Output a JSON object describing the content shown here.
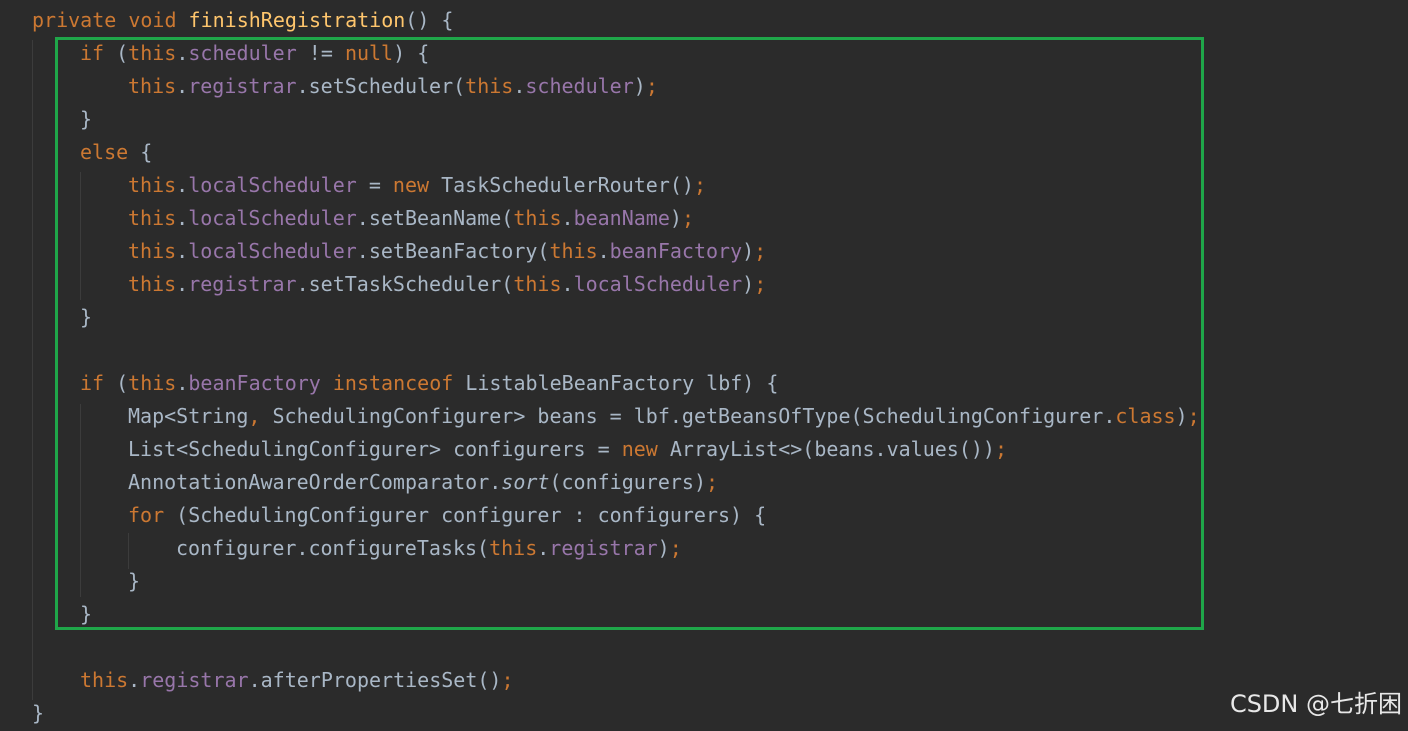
{
  "editor": {
    "theme_colors": {
      "background": "#2b2b2b",
      "keyword": "#cc7832",
      "field": "#9876aa",
      "method_declaration": "#ffc66d",
      "plain": "#a9b7c6",
      "highlight_border": "#1fa649"
    },
    "lines": [
      {
        "indent": 0,
        "tokens": [
          {
            "t": "private void ",
            "c": "keyword"
          },
          {
            "t": "finishRegistration",
            "c": "method_declaration"
          },
          {
            "t": "() {",
            "c": "plain"
          }
        ]
      },
      {
        "indent": 1,
        "tokens": [
          {
            "t": "if ",
            "c": "keyword"
          },
          {
            "t": "(",
            "c": "plain"
          },
          {
            "t": "this",
            "c": "keyword"
          },
          {
            "t": ".",
            "c": "plain"
          },
          {
            "t": "scheduler",
            "c": "field"
          },
          {
            "t": " != ",
            "c": "plain"
          },
          {
            "t": "null",
            "c": "keyword"
          },
          {
            "t": ") {",
            "c": "plain"
          }
        ]
      },
      {
        "indent": 2,
        "tokens": [
          {
            "t": "this",
            "c": "keyword"
          },
          {
            "t": ".",
            "c": "plain"
          },
          {
            "t": "registrar",
            "c": "field"
          },
          {
            "t": ".setScheduler(",
            "c": "plain"
          },
          {
            "t": "this",
            "c": "keyword"
          },
          {
            "t": ".",
            "c": "plain"
          },
          {
            "t": "scheduler",
            "c": "field"
          },
          {
            "t": ")",
            "c": "plain"
          },
          {
            "t": ";",
            "c": "keyword"
          }
        ]
      },
      {
        "indent": 1,
        "tokens": [
          {
            "t": "}",
            "c": "plain"
          }
        ]
      },
      {
        "indent": 1,
        "tokens": [
          {
            "t": "else ",
            "c": "keyword"
          },
          {
            "t": "{",
            "c": "plain"
          }
        ]
      },
      {
        "indent": 2,
        "tokens": [
          {
            "t": "this",
            "c": "keyword"
          },
          {
            "t": ".",
            "c": "plain"
          },
          {
            "t": "localScheduler",
            "c": "field"
          },
          {
            "t": " = ",
            "c": "plain"
          },
          {
            "t": "new ",
            "c": "keyword"
          },
          {
            "t": "TaskSchedulerRouter()",
            "c": "plain"
          },
          {
            "t": ";",
            "c": "keyword"
          }
        ]
      },
      {
        "indent": 2,
        "tokens": [
          {
            "t": "this",
            "c": "keyword"
          },
          {
            "t": ".",
            "c": "plain"
          },
          {
            "t": "localScheduler",
            "c": "field"
          },
          {
            "t": ".setBeanName(",
            "c": "plain"
          },
          {
            "t": "this",
            "c": "keyword"
          },
          {
            "t": ".",
            "c": "plain"
          },
          {
            "t": "beanName",
            "c": "field"
          },
          {
            "t": ")",
            "c": "plain"
          },
          {
            "t": ";",
            "c": "keyword"
          }
        ]
      },
      {
        "indent": 2,
        "tokens": [
          {
            "t": "this",
            "c": "keyword"
          },
          {
            "t": ".",
            "c": "plain"
          },
          {
            "t": "localScheduler",
            "c": "field"
          },
          {
            "t": ".setBeanFactory(",
            "c": "plain"
          },
          {
            "t": "this",
            "c": "keyword"
          },
          {
            "t": ".",
            "c": "plain"
          },
          {
            "t": "beanFactory",
            "c": "field"
          },
          {
            "t": ")",
            "c": "plain"
          },
          {
            "t": ";",
            "c": "keyword"
          }
        ]
      },
      {
        "indent": 2,
        "tokens": [
          {
            "t": "this",
            "c": "keyword"
          },
          {
            "t": ".",
            "c": "plain"
          },
          {
            "t": "registrar",
            "c": "field"
          },
          {
            "t": ".setTaskScheduler(",
            "c": "plain"
          },
          {
            "t": "this",
            "c": "keyword"
          },
          {
            "t": ".",
            "c": "plain"
          },
          {
            "t": "localScheduler",
            "c": "field"
          },
          {
            "t": ")",
            "c": "plain"
          },
          {
            "t": ";",
            "c": "keyword"
          }
        ]
      },
      {
        "indent": 1,
        "tokens": [
          {
            "t": "}",
            "c": "plain"
          }
        ]
      },
      {
        "indent": 0,
        "tokens": []
      },
      {
        "indent": 1,
        "tokens": [
          {
            "t": "if ",
            "c": "keyword"
          },
          {
            "t": "(",
            "c": "plain"
          },
          {
            "t": "this",
            "c": "keyword"
          },
          {
            "t": ".",
            "c": "plain"
          },
          {
            "t": "beanFactory",
            "c": "field"
          },
          {
            "t": " ",
            "c": "plain"
          },
          {
            "t": "instanceof ",
            "c": "keyword"
          },
          {
            "t": "ListableBeanFactory lbf) {",
            "c": "plain"
          }
        ]
      },
      {
        "indent": 2,
        "tokens": [
          {
            "t": "Map<String",
            "c": "plain"
          },
          {
            "t": ", ",
            "c": "keyword"
          },
          {
            "t": "SchedulingConfigurer> beans = lbf.getBeansOfType(SchedulingConfigurer.",
            "c": "plain"
          },
          {
            "t": "class",
            "c": "keyword"
          },
          {
            "t": ")",
            "c": "plain"
          },
          {
            "t": ";",
            "c": "keyword"
          }
        ]
      },
      {
        "indent": 2,
        "tokens": [
          {
            "t": "List<SchedulingConfigurer> configurers = ",
            "c": "plain"
          },
          {
            "t": "new ",
            "c": "keyword"
          },
          {
            "t": "ArrayList<>(beans.values())",
            "c": "plain"
          },
          {
            "t": ";",
            "c": "keyword"
          }
        ]
      },
      {
        "indent": 2,
        "tokens": [
          {
            "t": "AnnotationAwareOrderComparator.",
            "c": "plain"
          },
          {
            "t": "sort",
            "c": "italic"
          },
          {
            "t": "(configurers)",
            "c": "plain"
          },
          {
            "t": ";",
            "c": "keyword"
          }
        ]
      },
      {
        "indent": 2,
        "tokens": [
          {
            "t": "for ",
            "c": "keyword"
          },
          {
            "t": "(SchedulingConfigurer configurer : configurers) {",
            "c": "plain"
          }
        ]
      },
      {
        "indent": 3,
        "tokens": [
          {
            "t": "configurer.configureTasks(",
            "c": "plain"
          },
          {
            "t": "this",
            "c": "keyword"
          },
          {
            "t": ".",
            "c": "plain"
          },
          {
            "t": "registrar",
            "c": "field"
          },
          {
            "t": ")",
            "c": "plain"
          },
          {
            "t": ";",
            "c": "keyword"
          }
        ]
      },
      {
        "indent": 2,
        "tokens": [
          {
            "t": "}",
            "c": "plain"
          }
        ]
      },
      {
        "indent": 1,
        "tokens": [
          {
            "t": "}",
            "c": "plain"
          }
        ]
      },
      {
        "indent": 0,
        "tokens": []
      },
      {
        "indent": 1,
        "tokens": [
          {
            "t": "this",
            "c": "keyword"
          },
          {
            "t": ".",
            "c": "plain"
          },
          {
            "t": "registrar",
            "c": "field"
          },
          {
            "t": ".afterPropertiesSet()",
            "c": "plain"
          },
          {
            "t": ";",
            "c": "keyword"
          }
        ]
      },
      {
        "indent": 0,
        "tokens": [
          {
            "t": "}",
            "c": "plain"
          }
        ]
      }
    ]
  },
  "watermark": {
    "text": "CSDN @七折困"
  }
}
